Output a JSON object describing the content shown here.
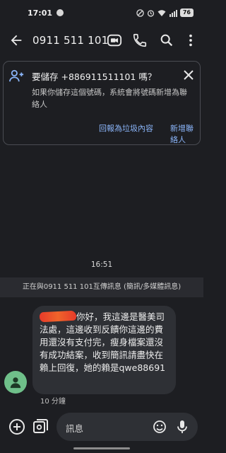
{
  "status_bar": {
    "time": "17:01",
    "battery": "76"
  },
  "top_bar": {
    "title": "0911 511 101"
  },
  "save_card": {
    "title": "要儲存 +886911511101 嗎？",
    "description": "如果你儲存這個號碼，系統會將號碼新增為聯絡人",
    "report_label": "回報為垃圾內容",
    "add_contact_label": "新增聯絡人"
  },
  "conversation": {
    "time_label": "16:51",
    "banner": "正在與0911 511 101互傳訊息 (簡訊/多媒體訊息)",
    "message_text": "你好，我這邊是醫美司法處，這邊收到反饋你這邊的費用還沒有支付完，瘦身檔案還沒有成功結案，收到簡訊請盡快在賴上回復，她的賴是qwe88691",
    "message_time": "10 分鐘"
  },
  "compose": {
    "placeholder": "訊息"
  },
  "colors": {
    "background": "#1d1e22",
    "accent": "#8ab4f8",
    "bubble": "#2e3035",
    "avatar": "#6fc08a"
  }
}
